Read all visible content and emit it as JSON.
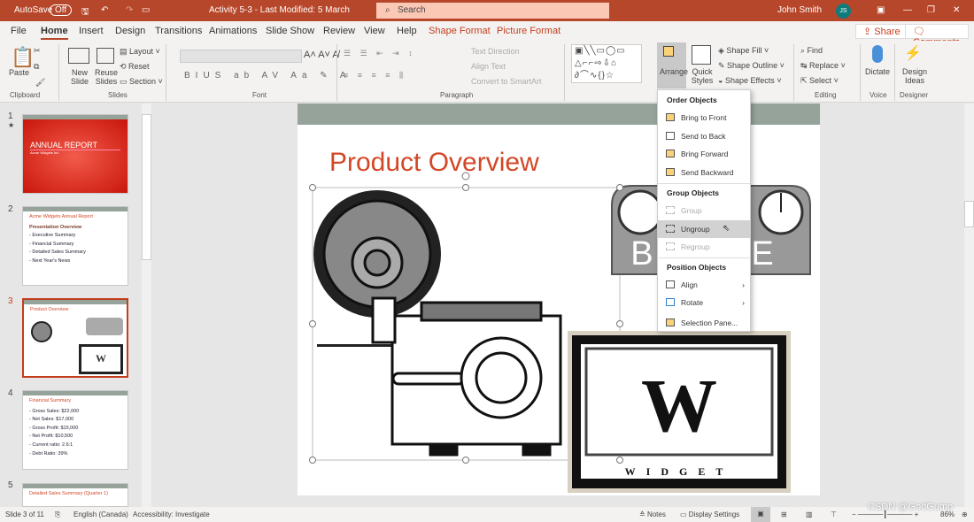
{
  "titlebar": {
    "autosave": "AutoSave",
    "autosave_state": "Off",
    "doc_title": "Activity 5-3  -  Last Modified: 5 March",
    "search_placeholder": "Search",
    "user": "John Smith",
    "user_initials": "JS"
  },
  "tabs": [
    "File",
    "Home",
    "Insert",
    "Design",
    "Transitions",
    "Animations",
    "Slide Show",
    "Review",
    "View",
    "Help",
    "Shape Format",
    "Picture Format"
  ],
  "share": "Share",
  "comments": "Comments",
  "ribbon": {
    "paste": "Paste",
    "new_slide": "New Slide",
    "reuse_slides": "Reuse Slides",
    "layout": "Layout",
    "reset": "Reset",
    "section": "Section",
    "text_direction": "Text Direction",
    "align_text": "Align Text",
    "convert_smartart": "Convert to SmartArt",
    "arrange": "Arrange",
    "quick_styles": "Quick Styles",
    "shape_fill": "Shape Fill",
    "shape_outline": "Shape Outline",
    "shape_effects": "Shape Effects",
    "find": "Find",
    "replace": "Replace",
    "select": "Select",
    "dictate": "Dictate",
    "design_ideas": "Design Ideas",
    "groups": [
      "Clipboard",
      "Slides",
      "Font",
      "Paragraph",
      "Editing",
      "Voice",
      "Designer"
    ]
  },
  "menu": {
    "order_header": "Order Objects",
    "bring_front": "Bring to Front",
    "send_back": "Send to Back",
    "bring_forward": "Bring Forward",
    "send_backward": "Send Backward",
    "group_header": "Group Objects",
    "group": "Group",
    "ungroup": "Ungroup",
    "regroup": "Regroup",
    "position_header": "Position Objects",
    "align": "Align",
    "rotate": "Rotate",
    "selection_pane": "Selection Pane..."
  },
  "slides": [
    {
      "num": "1",
      "title": "ANNUAL REPORT",
      "subtitle": "Acme Widgets Inc"
    },
    {
      "num": "2",
      "title": "Acme Widgets Annual Report",
      "heading": "Presentation Overview",
      "lines": [
        "- Executive Summary",
        "- Financial Summary",
        "- Detailed Sales Summary",
        "- Next Year's News"
      ]
    },
    {
      "num": "3",
      "title": "Product Overview"
    },
    {
      "num": "4",
      "title": "Financial Summary",
      "lines": [
        "- Gross Sales: $22,000",
        "- Net Sales: $17,000",
        "- Gross Profit: $15,000",
        "- Net Profit: $10,500",
        "- Current ratio: 2.6:1",
        "- Debt Ratio: 39%"
      ]
    },
    {
      "num": "5",
      "title": "Detailed Sales Summary (Quarter 1)"
    }
  ],
  "main_slide": {
    "title": "Product Overview",
    "logo_text": "BASE",
    "sign_letter": "W",
    "sign_word": "WIDGET"
  },
  "status": {
    "slide": "Slide 3 of 11",
    "language": "English (Canada)",
    "accessibility": "Accessibility: Investigate",
    "notes": "Notes",
    "display": "Display Settings",
    "zoom": "86%",
    "watermark": "CSDN @GodGump"
  },
  "colors": {
    "accent": "#b7472a",
    "title_red": "#d24726"
  }
}
